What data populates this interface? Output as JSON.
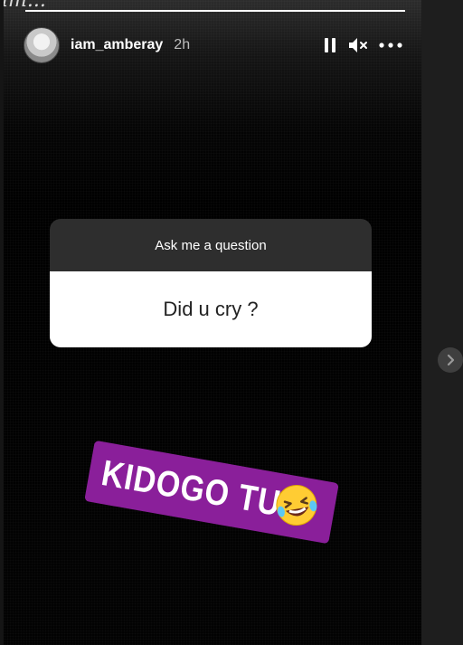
{
  "story": {
    "progress_fraction": 1.0,
    "username": "iam_amberay",
    "time_ago": "2h",
    "controls": {
      "pause_icon": "pause-icon",
      "mute_icon": "speaker-muted-icon",
      "more_icon": "more-horizontal-icon"
    }
  },
  "question_sticker": {
    "prompt": "Ask me a question",
    "answer": "Did u cry ?"
  },
  "text_sticker": {
    "text": "KIDOGO TU",
    "emoji": "rolling-on-floor-laughing-emoji",
    "background_color": "#8a1f9a"
  },
  "navigation": {
    "next_icon": "chevron-right-icon"
  }
}
